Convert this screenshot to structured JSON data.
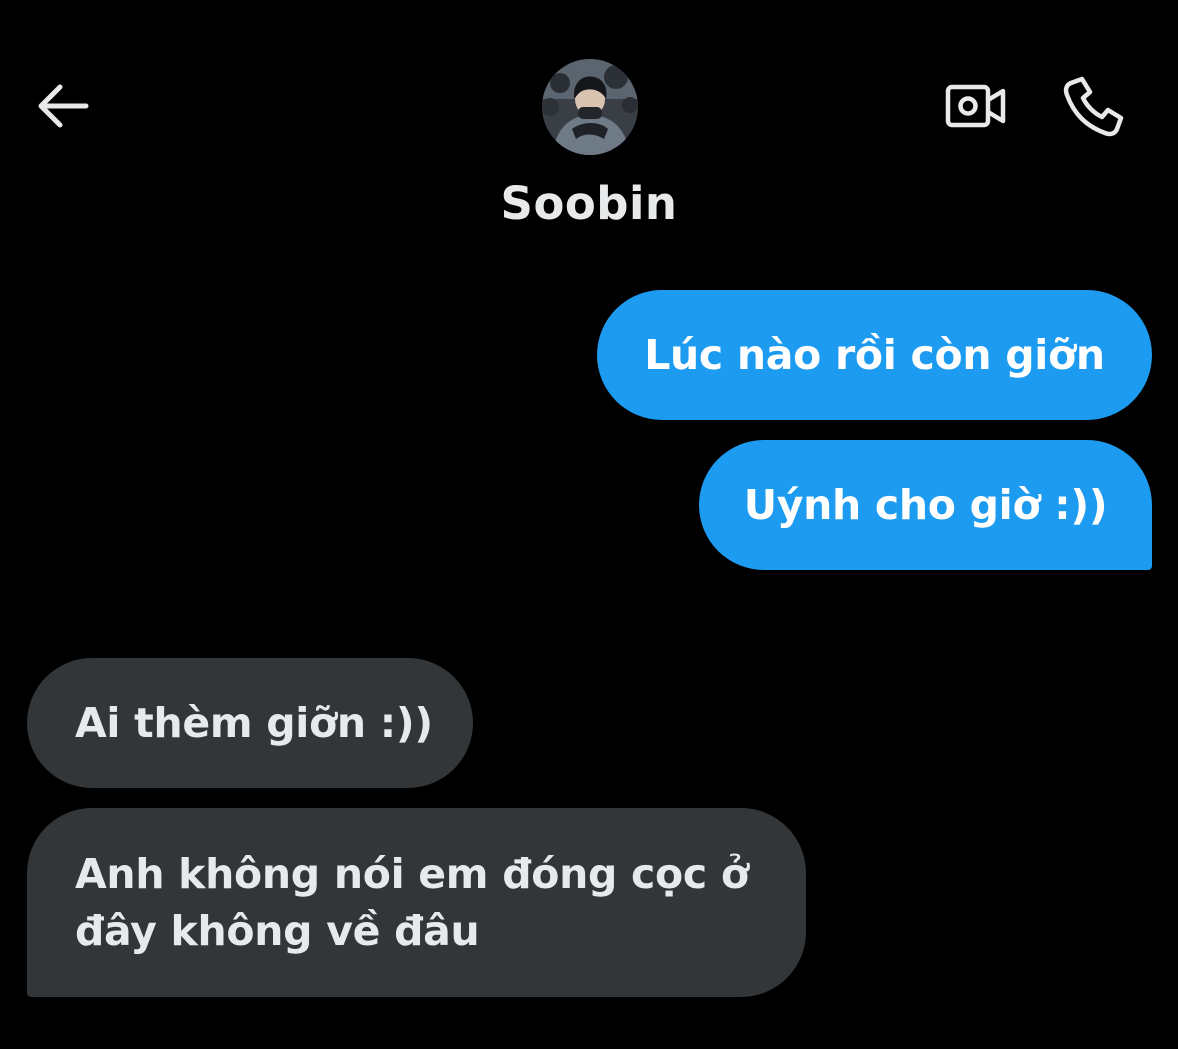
{
  "header": {
    "contact_name": "Soobin",
    "back_icon": "arrow-left-icon",
    "video_icon": "video-camera-icon",
    "call_icon": "phone-icon"
  },
  "colors": {
    "background": "#000000",
    "sent_bubble": "#1d9bf0",
    "received_bubble": "#333639",
    "text": "#e7e9ea"
  },
  "messages": [
    {
      "direction": "sent",
      "text": "Lúc nào rồi còn giỡn"
    },
    {
      "direction": "sent",
      "text": "Uýnh cho giờ :))"
    },
    {
      "direction": "received",
      "text": "Ai thèm giỡn :))"
    },
    {
      "direction": "received",
      "text": "Anh không nói em đóng cọc ở đây không về đâu"
    }
  ]
}
